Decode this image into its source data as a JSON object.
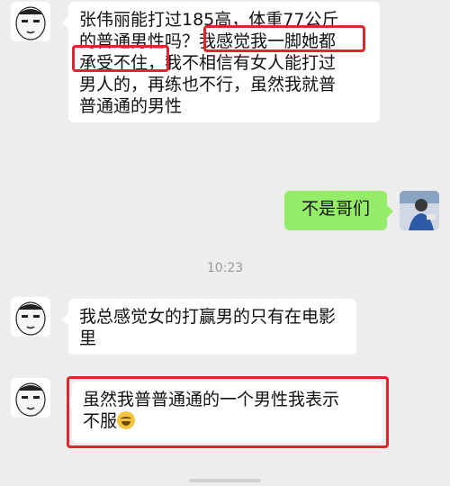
{
  "messages": [
    {
      "sender": "friend",
      "lines": [
        "张伟丽能打过185高，体重77公斤",
        "的普通男性吗？我感觉我一脚她都",
        "承受不住，我不相信有女人能打过",
        "男人的，再练也不行，虽然我就普",
        "普通通的男性"
      ]
    },
    {
      "sender": "me",
      "text": "不是哥们"
    },
    {
      "sender": "friend",
      "lines": [
        "我总感觉女的打赢男的只有在电影",
        "里"
      ]
    },
    {
      "sender": "friend",
      "lines": [
        "虽然我普普通通的一个男性我表示",
        "不服"
      ]
    }
  ],
  "timestamp": "10:23",
  "colors": {
    "background": "#ededed",
    "my_bubble": "#95ec69",
    "highlight": "#e0262b"
  },
  "icons": [
    "meme-face-avatar",
    "user-photo-avatar",
    "laughing-tears-emoji"
  ]
}
